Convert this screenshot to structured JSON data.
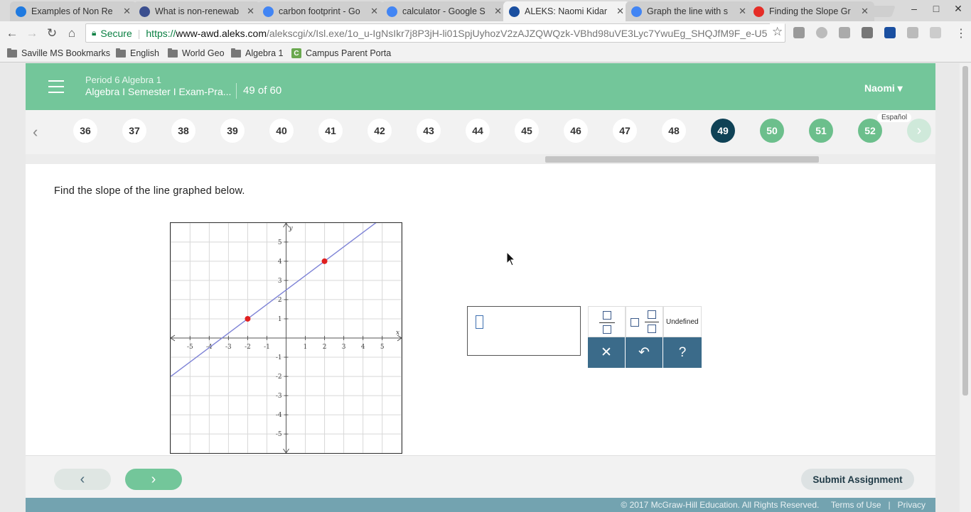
{
  "browser": {
    "tabs": [
      {
        "title": "Examples of Non Re",
        "favicon": "ixl-icon",
        "favicon_color": "#1f7ae0"
      },
      {
        "title": "What is non-renewab",
        "favicon": "bd-icon",
        "favicon_color": "#3b4f8f"
      },
      {
        "title": "carbon footprint - Go",
        "favicon": "google-icon",
        "favicon_color": "#4285f4"
      },
      {
        "title": "calculator - Google S",
        "favicon": "google-icon",
        "favicon_color": "#4285f4"
      },
      {
        "title": "ALEKS: Naomi Kidar",
        "favicon": "aleks-icon",
        "favicon_color": "#1a4fa0",
        "active": true
      },
      {
        "title": "Graph the line with s",
        "favicon": "google-icon",
        "favicon_color": "#4285f4"
      },
      {
        "title": "Finding the Slope Gr",
        "favicon": "youtube-icon",
        "favicon_color": "#e52d27"
      }
    ],
    "secure_label": "Secure",
    "url_scheme": "https://",
    "url_host": "www-awd.aleks.com",
    "url_path": "/alekscgi/x/Isl.exe/1o_u-IgNsIkr7j8P3jH-li01SpjUyhozV2zAJZQWQzk-VBhd98uVE3Lyc7YwuEg_SHQJfM9F_e-U5",
    "bookmarks": [
      {
        "label": "Saville MS Bookmarks"
      },
      {
        "label": "English"
      },
      {
        "label": "World Geo"
      },
      {
        "label": "Algebra 1"
      },
      {
        "label": "Campus Parent Porta"
      }
    ]
  },
  "header": {
    "course": "Period 6 Algebra 1",
    "assignment": "Algebra I Semester I Exam-Pra...",
    "progress": "49 of 60",
    "user": "Naomi ▾",
    "language": "Español"
  },
  "nav": {
    "questions": [
      "36",
      "37",
      "38",
      "39",
      "40",
      "41",
      "42",
      "43",
      "44",
      "45",
      "46",
      "47",
      "48",
      "49",
      "50",
      "51",
      "52"
    ],
    "current": "49",
    "upcoming": [
      "50",
      "51",
      "52"
    ]
  },
  "question": {
    "prompt": "Find the slope of the line graphed below."
  },
  "chart_data": {
    "type": "line",
    "xlabel": "x",
    "ylabel": "y",
    "xlim": [
      -6,
      6
    ],
    "ylim": [
      -6,
      6
    ],
    "x_ticks": [
      -5,
      -4,
      -3,
      -2,
      -1,
      1,
      2,
      3,
      4,
      5
    ],
    "y_ticks": [
      -5,
      -4,
      -3,
      -2,
      -1,
      1,
      2,
      3,
      4,
      5
    ],
    "grid": true,
    "series": [
      {
        "points": [
          [
            -2,
            1
          ],
          [
            2,
            4
          ]
        ],
        "line": "through-points",
        "color": "#7d82d6",
        "marker_color": "#e02020"
      }
    ]
  },
  "palette": {
    "undefined_label": "Undefined",
    "clear_symbol": "✕",
    "undo_symbol": "↶",
    "help_symbol": "?"
  },
  "footer": {
    "back_symbol": "‹",
    "next_symbol": "›",
    "submit_label": "Submit Assignment",
    "copyright": "© 2017 McGraw-Hill Education. All Rights Reserved.",
    "terms": "Terms of Use",
    "divider": "|",
    "privacy": "Privacy"
  }
}
